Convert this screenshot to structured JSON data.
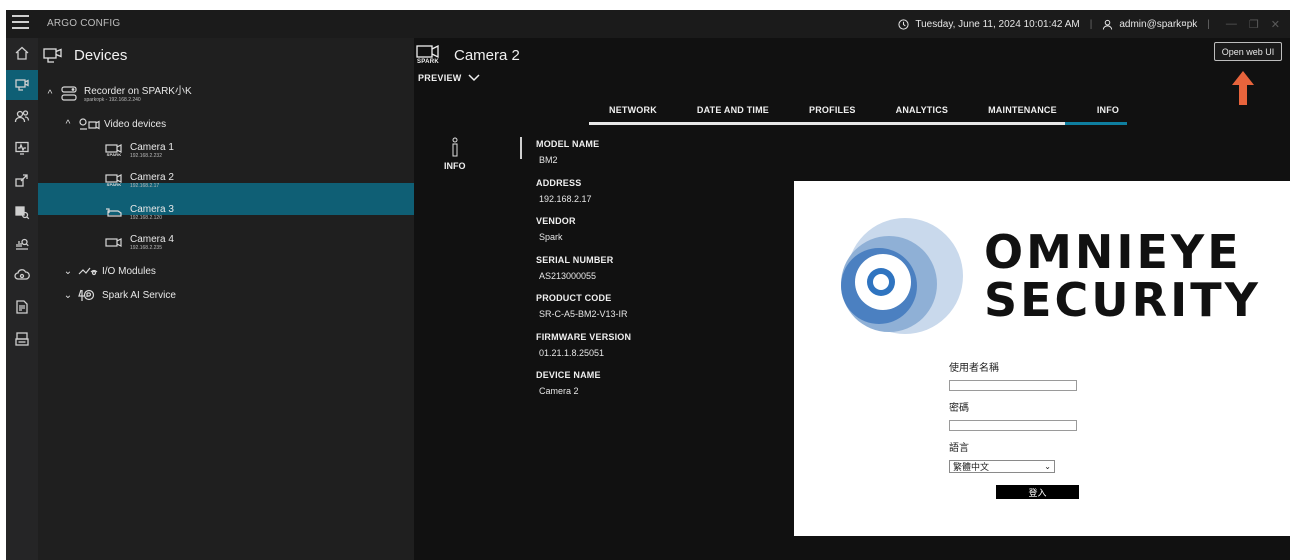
{
  "app": {
    "title": "ARGO CONFIG"
  },
  "titlebar": {
    "datetime": "Tuesday, June 11, 2024 10:01:42 AM",
    "user": "admin@spark¤pk"
  },
  "rail": {
    "items": [
      "home-icon",
      "devices-icon",
      "users-icon",
      "monitor-icon",
      "export-icon",
      "search-camera-icon",
      "analytics-icon",
      "cloud-icon",
      "report-icon",
      "log-icon"
    ]
  },
  "tree": {
    "title": "Devices",
    "recorder": {
      "name": "Recorder on SPARK小K",
      "address": "spark¤pk - 192.168.2.240"
    },
    "video_devices": "Video devices",
    "spark_badge": "SPARK",
    "cameras": [
      {
        "name": "Camera 1",
        "ip": "192.168.2.232"
      },
      {
        "name": "Camera 2",
        "ip": "192.168.2.17"
      },
      {
        "name": "Camera 3",
        "ip": "192.168.2.120"
      },
      {
        "name": "Camera 4",
        "ip": "192.168.2.235"
      }
    ],
    "io_modules": "I/O Modules",
    "ai_service": "Spark AI Service"
  },
  "main": {
    "title": "Camera 2",
    "spark_badge": "SPARK",
    "open_web_ui": "Open web UI",
    "preview": "PREVIEW",
    "tabs": [
      "NETWORK",
      "DATE AND TIME",
      "PROFILES",
      "ANALYTICS",
      "MAINTENANCE",
      "INFO"
    ],
    "active_tab": "INFO",
    "info_label": "INFO",
    "fields": [
      {
        "key": "MODEL NAME",
        "value": "BM2"
      },
      {
        "key": "ADDRESS",
        "value": "192.168.2.17"
      },
      {
        "key": "VENDOR",
        "value": "Spark"
      },
      {
        "key": "SERIAL NUMBER",
        "value": "AS213000055"
      },
      {
        "key": "PRODUCT CODE",
        "value": "SR-C-A5-BM2-V13-IR"
      },
      {
        "key": "FIRMWARE VERSION",
        "value": "01.21.1.8.25051"
      },
      {
        "key": "DEVICE NAME",
        "value": "Camera 2"
      }
    ]
  },
  "web_ui": {
    "brand_line1": "OMNIEYE",
    "brand_line2": "SECURITY",
    "username_label": "使用者名稱",
    "password_label": "密碼",
    "language_label": "語言",
    "language_value": "繁體中文",
    "login_button": "登入"
  },
  "colors": {
    "accent": "#0f5f75",
    "arrow": "#e8643c",
    "tab_active": "#0f7fa0"
  }
}
